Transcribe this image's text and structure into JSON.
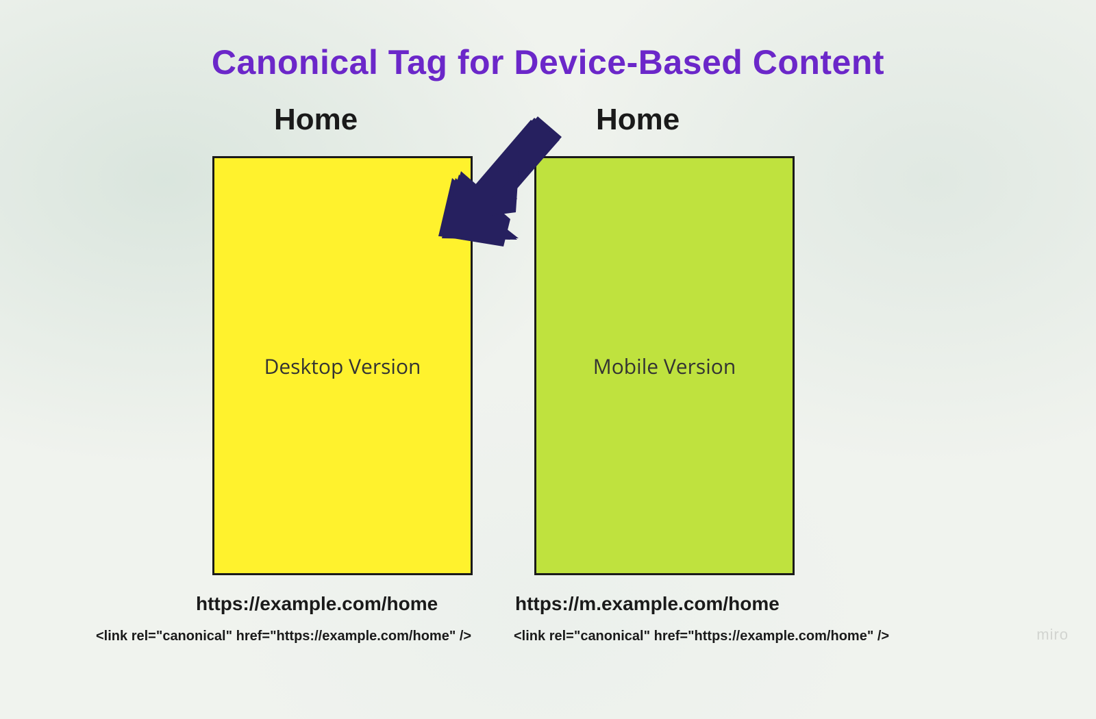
{
  "title": "Canonical Tag for Device-Based Content",
  "columns": {
    "left": {
      "heading": "Home",
      "panel_label": "Desktop Version",
      "url": "https://example.com/home",
      "link_tag": "<link rel=\"canonical\" href=\"https://example.com/home\" />"
    },
    "right": {
      "heading": "Home",
      "panel_label": "Mobile Version",
      "url": "https://m.example.com/home",
      "link_tag": "<link rel=\"canonical\" href=\"https://example.com/home\" />"
    }
  },
  "arrow": {
    "color": "#26205f",
    "direction": "down-left",
    "from": "right-column",
    "to": "left-panel"
  },
  "watermark": "miro"
}
